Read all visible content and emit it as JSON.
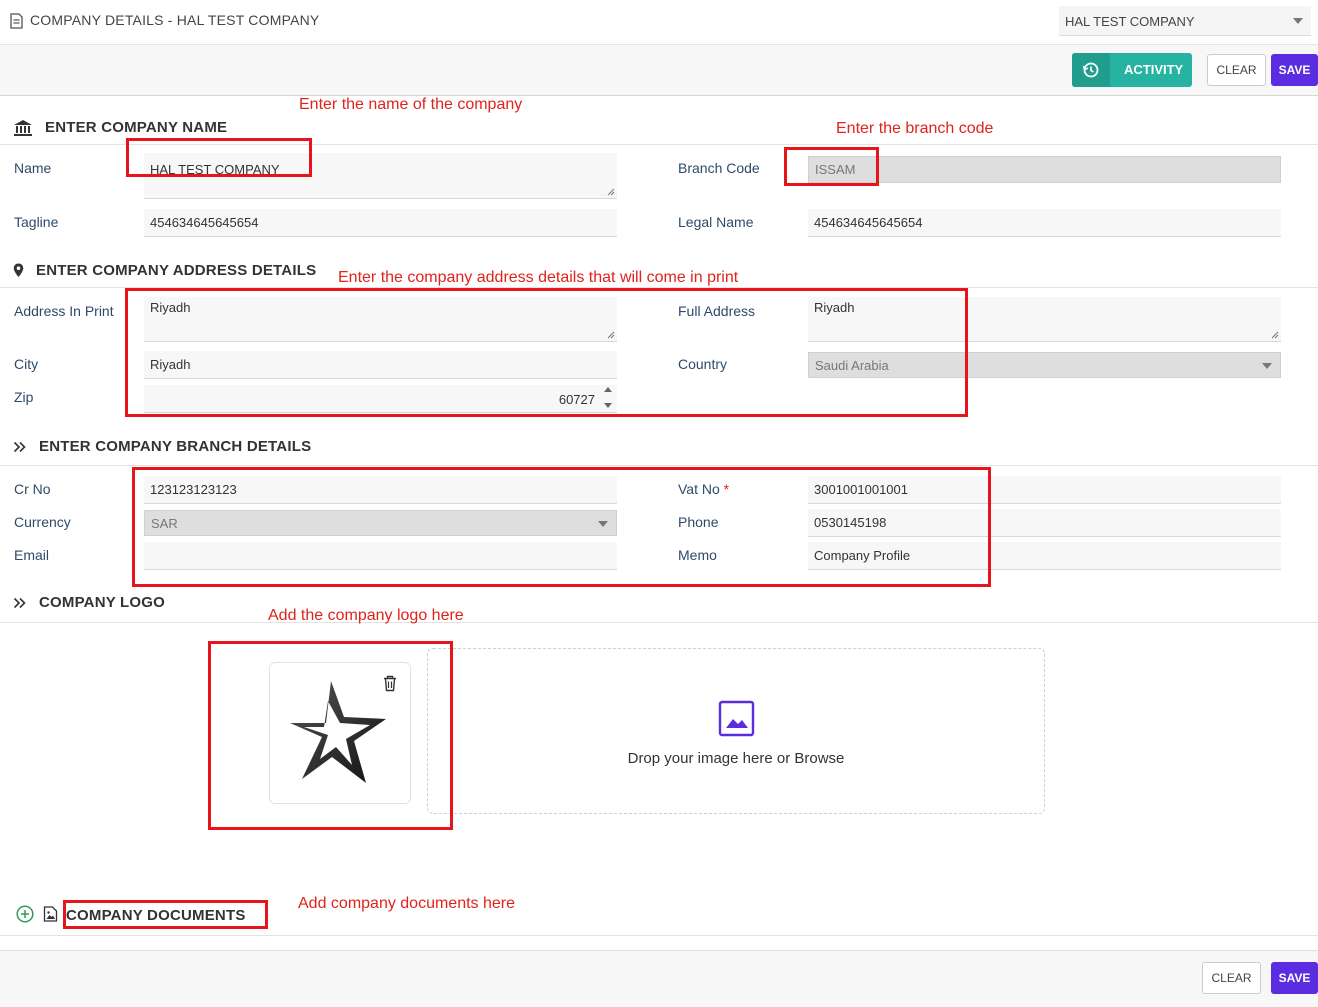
{
  "header": {
    "title": "COMPANY DETAILS - HAL TEST COMPANY",
    "company_selector": "HAL TEST COMPANY"
  },
  "toolbar": {
    "activity_label": "ACTIVITY",
    "clear_label": "CLEAR",
    "save_label": "SAVE"
  },
  "sections": {
    "company_name": "ENTER COMPANY NAME",
    "address": "ENTER COMPANY ADDRESS DETAILS",
    "branch": "ENTER COMPANY BRANCH DETAILS",
    "logo": "COMPANY LOGO",
    "documents": "COMPANY DOCUMENTS"
  },
  "labels": {
    "name": "Name",
    "tagline": "Tagline",
    "branch_code": "Branch Code",
    "legal_name": "Legal Name",
    "address_in_print": "Address In Print",
    "full_address": "Full Address",
    "city": "City",
    "country": "Country",
    "zip": "Zip",
    "cr_no": "Cr No",
    "vat_no": "Vat No",
    "vat_required": "*",
    "currency": "Currency",
    "phone": "Phone",
    "email": "Email",
    "memo": "Memo"
  },
  "values": {
    "name": "HAL TEST COMPANY",
    "tagline": "454634645645654",
    "branch_code": "ISSAM",
    "legal_name": "454634645645654",
    "address_in_print": "Riyadh",
    "full_address": "Riyadh",
    "city": "Riyadh",
    "country": "Saudi Arabia",
    "zip": "60727",
    "cr_no": "123123123123",
    "vat_no": "3001001001001",
    "currency": "SAR",
    "phone": "0530145198",
    "email": "",
    "memo": "Company Profile"
  },
  "logo": {
    "dropzone_text": "Drop your image here or Browse"
  },
  "annotations": {
    "name": "Enter the name of the company",
    "branch_code": "Enter the branch code",
    "address": "Enter the company address details that will come in print",
    "logo": "Add the company logo here",
    "documents": "Add company documents here"
  },
  "footer": {
    "clear_label": "CLEAR",
    "save_label": "SAVE"
  },
  "colors": {
    "accent": "#5a2ee0",
    "activity": "#27b3a1",
    "annotation": "#e0231c",
    "add_icon": "#2e9e4f"
  },
  "icons": [
    "document-icon",
    "history-icon",
    "bank-icon",
    "map-pin-icon",
    "double-chevron-icon",
    "trash-icon",
    "image-icon",
    "add-circle-icon",
    "file-image-icon"
  ]
}
